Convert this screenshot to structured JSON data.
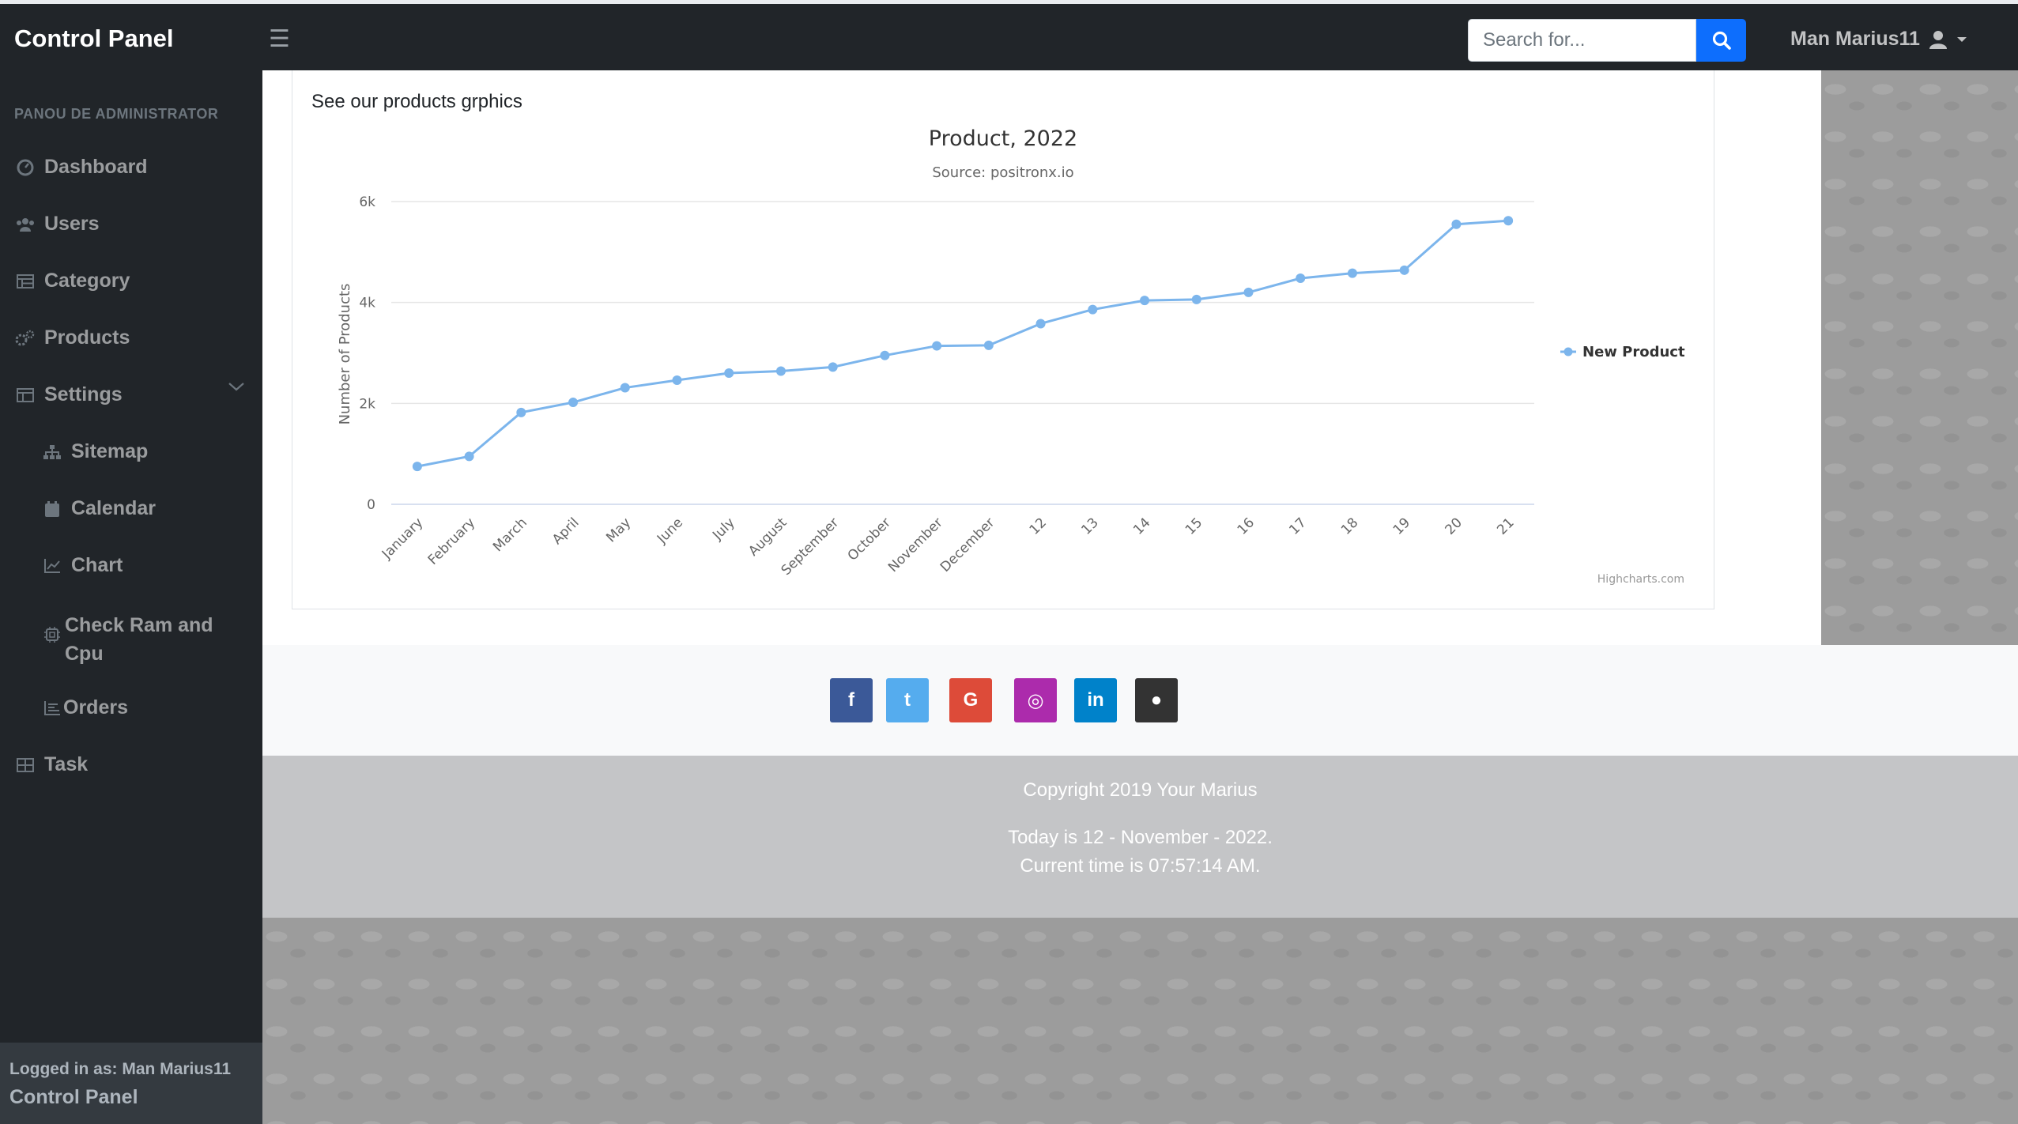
{
  "app": {
    "brand": "Control Panel"
  },
  "search": {
    "placeholder": "Search for..."
  },
  "user": {
    "name": "Man Marius11"
  },
  "sidebar": {
    "heading": "PANOU DE ADMINISTRATOR",
    "items": [
      {
        "label": "Dashboard",
        "icon": "dashboard-icon"
      },
      {
        "label": "Users",
        "icon": "users-icon"
      },
      {
        "label": "Category",
        "icon": "table-list-icon"
      },
      {
        "label": "Products",
        "icon": "cogs-icon"
      },
      {
        "label": "Settings",
        "icon": "columns-icon"
      },
      {
        "label": "Sitemap",
        "icon": "sitemap-icon"
      },
      {
        "label": "Calendar",
        "icon": "calendar-icon"
      },
      {
        "label": "Chart",
        "icon": "chart-line-icon"
      },
      {
        "label": "Check Ram and Cpu",
        "icon": "cpu-icon"
      },
      {
        "label": "Orders",
        "icon": "list-icon"
      },
      {
        "label": "Task",
        "icon": "table-icon"
      }
    ],
    "footer": {
      "logged_in": "Logged in as: Man Marius11",
      "app": "Control Panel"
    }
  },
  "card": {
    "title": "See our products grphics"
  },
  "chart_data": {
    "type": "line",
    "title": "Product, 2022",
    "subtitle": "Source: positronx.io",
    "ylabel": "Number of Products",
    "xlabel": "",
    "ylim": [
      0,
      6000
    ],
    "yticks": [
      "0",
      "2k",
      "4k",
      "6k"
    ],
    "grid": true,
    "legend_position": "right",
    "credits": "Highcharts.com",
    "categories": [
      "January",
      "February",
      "March",
      "April",
      "May",
      "June",
      "July",
      "August",
      "September",
      "October",
      "November",
      "December",
      "12",
      "13",
      "14",
      "15",
      "16",
      "17",
      "18",
      "19",
      "20",
      "21"
    ],
    "series": [
      {
        "name": "New Product",
        "color": "#7cb5ec",
        "values": [
          750,
          950,
          1820,
          2020,
          2310,
          2460,
          2600,
          2640,
          2720,
          2950,
          3140,
          3150,
          3580,
          3860,
          4040,
          4060,
          4200,
          4480,
          4580,
          4640,
          5550,
          5620
        ]
      }
    ]
  },
  "social": [
    {
      "name": "facebook",
      "glyph": "f",
      "color": "#3b5998"
    },
    {
      "name": "twitter",
      "glyph": "t",
      "color": "#55acee"
    },
    {
      "name": "google",
      "glyph": "G",
      "color": "#dd4b39"
    },
    {
      "name": "instagram",
      "glyph": "◎",
      "color": "#ac2bac"
    },
    {
      "name": "linkedin",
      "glyph": "in",
      "color": "#0082ca"
    },
    {
      "name": "github",
      "glyph": "●",
      "color": "#333333"
    }
  ],
  "footer": {
    "copyright": "Copyright 2019 Your Marius",
    "today": "Today is 12 - November - 2022.",
    "time": "Current time is 07:57:14 AM."
  },
  "colors": {
    "topbar": "#212529",
    "accent": "#0d6efd",
    "series": "#7cb5ec"
  }
}
